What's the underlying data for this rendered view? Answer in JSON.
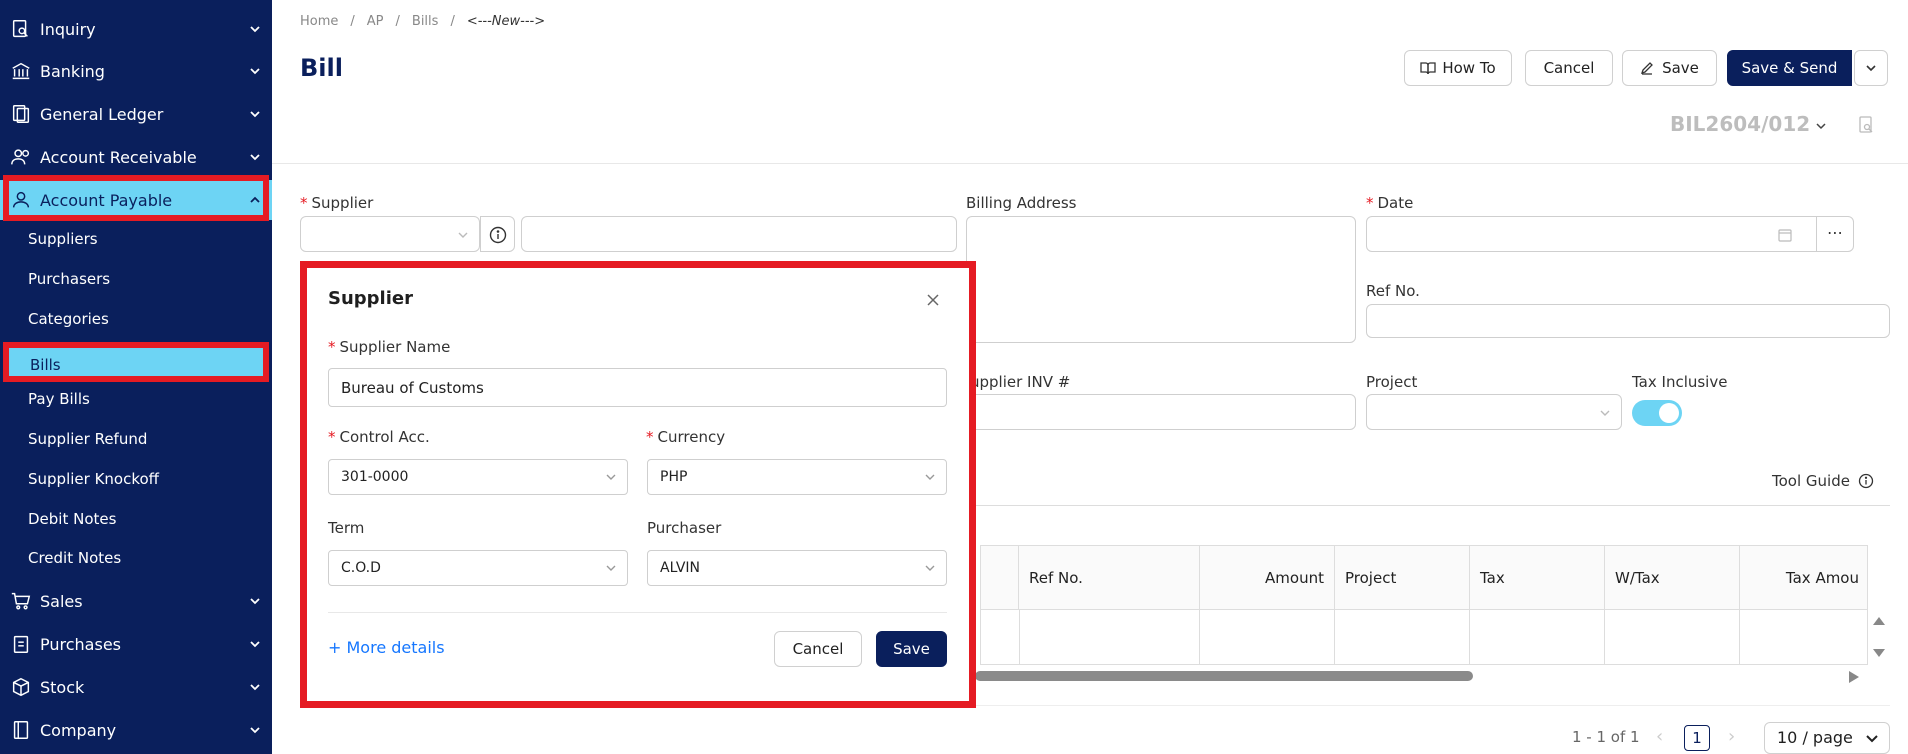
{
  "sidebar": {
    "items": [
      {
        "label": "Inquiry",
        "icon": "search-doc-icon"
      },
      {
        "label": "Banking",
        "icon": "bank-icon"
      },
      {
        "label": "General Ledger",
        "icon": "ledger-icon"
      },
      {
        "label": "Account Receivable",
        "icon": "users-icon"
      },
      {
        "label": "Account Payable",
        "icon": "user-icon"
      },
      {
        "label": "Sales",
        "icon": "cart-icon"
      },
      {
        "label": "Purchases",
        "icon": "clipboard-icon"
      },
      {
        "label": "Stock",
        "icon": "box-icon"
      },
      {
        "label": "Company",
        "icon": "book-icon"
      }
    ],
    "sub_items": [
      "Suppliers",
      "Purchasers",
      "Categories",
      "Bills",
      "Pay Bills",
      "Supplier Refund",
      "Supplier Knockoff",
      "Debit Notes",
      "Credit Notes"
    ]
  },
  "breadcrumb": [
    "Home",
    "AP",
    "Bills",
    "<---New--->"
  ],
  "page_title": "Bill",
  "toolbar": {
    "how_to": "How To",
    "cancel": "Cancel",
    "save": "Save",
    "save_send": "Save & Send"
  },
  "doc_no": "BIL2604/012",
  "form": {
    "supplier_label": "Supplier",
    "billing_address_label": "Billing Address",
    "date_label": "Date",
    "ref_no_label": "Ref No.",
    "supplier_inv_label": "upplier INV #",
    "project_label": "Project",
    "tax_inclusive_label": "Tax Inclusive",
    "tax_inclusive": true,
    "tool_guide": "Tool Guide"
  },
  "table": {
    "headers": [
      "Ref No.",
      "Amount",
      "Project",
      "Tax",
      "W/Tax",
      "Tax Amou"
    ]
  },
  "pagination": {
    "summary": "1 - 1 of 1",
    "current_page": "1",
    "page_size": "10 / page"
  },
  "modal": {
    "title": "Supplier",
    "supplier_name_label": "Supplier Name",
    "supplier_name_value": "Bureau of Customs",
    "control_acc_label": "Control Acc.",
    "control_acc_value": "301-0000",
    "currency_label": "Currency",
    "currency_value": "PHP",
    "term_label": "Term",
    "term_value": "C.O.D",
    "purchaser_label": "Purchaser",
    "purchaser_value": "ALVIN",
    "more_details": "+ More details",
    "cancel": "Cancel",
    "save": "Save"
  },
  "colors": {
    "navy": "#0a1f5c",
    "active_cyan": "#6dd4f4",
    "highlight_red": "#e51b23",
    "link_blue": "#1677ff"
  }
}
